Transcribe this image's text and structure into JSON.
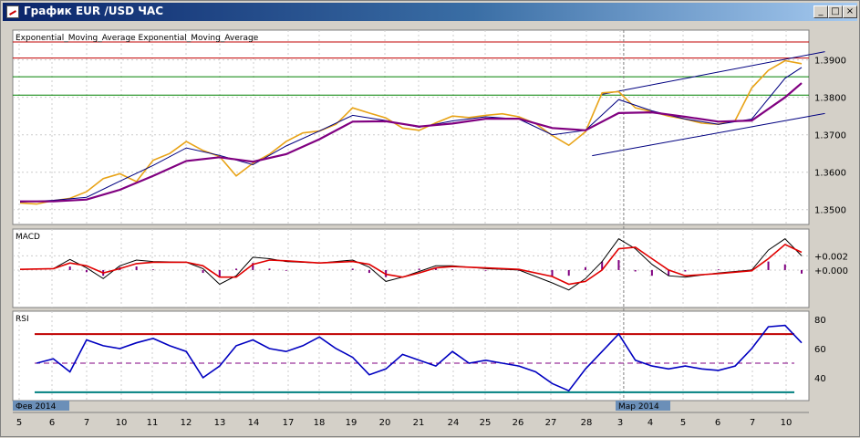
{
  "window": {
    "title": "График EUR /USD  ЧАС",
    "min_glyph": "_",
    "max_glyph": "□",
    "close_glyph": "×"
  },
  "chart_data": [
    {
      "type": "line",
      "title": "Exponential_Moving_Average Exponential_Moving_Average",
      "ylim": [
        1.3475,
        1.3965
      ],
      "y_ticks": [
        "1.3500",
        "1.3600",
        "1.3700",
        "1.3800",
        "1.3900"
      ],
      "x_ticks": [
        "5",
        "6",
        "7",
        "10",
        "11",
        "12",
        "13",
        "14",
        "17",
        "18",
        "19",
        "20",
        "21",
        "24",
        "25",
        "26",
        "27",
        "28",
        "3",
        "4",
        "5",
        "6",
        "7",
        "10"
      ],
      "period_labels": [
        "Фев 2014",
        "Мар 2014"
      ],
      "series": [
        {
          "color": "#e8a317",
          "x": [
            0,
            0.5,
            1,
            1.5,
            2,
            2.5,
            3,
            3.5,
            4,
            4.5,
            5,
            5.5,
            6,
            6.5,
            7,
            7.5,
            8,
            8.5,
            9,
            9.5,
            10,
            10.5,
            11,
            11.5,
            12,
            12.5,
            13,
            13.5,
            14,
            14.5,
            15,
            15.5,
            16,
            16.5,
            17,
            17.5,
            18,
            18.5,
            19,
            19.5,
            20,
            20.5,
            21,
            21.5,
            22,
            22.5,
            23,
            23.5
          ],
          "y": [
            1.3518,
            1.3515,
            1.3524,
            1.353,
            1.3548,
            1.3583,
            1.3596,
            1.3575,
            1.3632,
            1.365,
            1.3682,
            1.3658,
            1.3642,
            1.359,
            1.3624,
            1.3648,
            1.3682,
            1.3705,
            1.371,
            1.3728,
            1.3772,
            1.3758,
            1.3745,
            1.3718,
            1.3712,
            1.3732,
            1.375,
            1.3746,
            1.3752,
            1.3756,
            1.3748,
            1.373,
            1.3698,
            1.3672,
            1.3708,
            1.3812,
            1.3815,
            1.3772,
            1.3762,
            1.375,
            1.3742,
            1.3731,
            1.3728,
            1.3738,
            1.3825,
            1.3872,
            1.3898,
            1.389
          ]
        },
        {
          "color": "#000080",
          "x": [
            0,
            1,
            2,
            3,
            4,
            5,
            6,
            7,
            8,
            9,
            10,
            11,
            12,
            13,
            14,
            15,
            16,
            17,
            18,
            19,
            20,
            21,
            22,
            23,
            23.5
          ],
          "y": [
            1.352,
            1.3525,
            1.3533,
            1.3576,
            1.3618,
            1.3665,
            1.3645,
            1.362,
            1.367,
            1.371,
            1.3752,
            1.3738,
            1.372,
            1.3737,
            1.3748,
            1.3742,
            1.37,
            1.3712,
            1.3794,
            1.3764,
            1.3742,
            1.3728,
            1.3742,
            1.3851,
            1.388
          ]
        },
        {
          "color": "#800080",
          "x": [
            0,
            1,
            2,
            3,
            4,
            5,
            6,
            7,
            8,
            9,
            10,
            11,
            12,
            13,
            14,
            15,
            16,
            17,
            18,
            19,
            20,
            21,
            22,
            23,
            23.5
          ],
          "y": [
            1.3522,
            1.3522,
            1.3527,
            1.3553,
            1.359,
            1.363,
            1.364,
            1.3628,
            1.3648,
            1.3688,
            1.3735,
            1.3736,
            1.3722,
            1.373,
            1.3743,
            1.3743,
            1.3718,
            1.3712,
            1.3758,
            1.376,
            1.3748,
            1.3735,
            1.3738,
            1.38,
            1.3838
          ]
        }
      ],
      "hlines": [
        {
          "value": 1.3948,
          "color": "#c00000"
        },
        {
          "value": 1.3905,
          "color": "#c00000"
        },
        {
          "value": 1.3855,
          "color": "#008000"
        },
        {
          "value": 1.3806,
          "color": "#008000"
        }
      ],
      "trendlines": [
        {
          "x": [
            17.5,
            24.2
          ],
          "y": [
            1.3808,
            1.3922
          ],
          "color": "#000080"
        },
        {
          "x": [
            17.2,
            24.2
          ],
          "y": [
            1.3644,
            1.3757
          ],
          "color": "#000080"
        }
      ],
      "cursor_x": 18.15
    },
    {
      "type": "line",
      "title": "MACD",
      "ylim": [
        -0.0045,
        0.005
      ],
      "y_ticks": [
        "+0.002",
        "+0.000"
      ],
      "y_tick_values": [
        0.002,
        0.0
      ],
      "series": [
        {
          "color": "#000000",
          "x": [
            0,
            1,
            1.5,
            2,
            2.5,
            3,
            3.5,
            4,
            5,
            5.5,
            6,
            6.5,
            7,
            7.5,
            8,
            9,
            10,
            10.5,
            11,
            11.5,
            12,
            12.5,
            13,
            14,
            15,
            16,
            16.5,
            17,
            17.5,
            18,
            18.5,
            19,
            19.5,
            20,
            21,
            22,
            22.5,
            23,
            23.5
          ],
          "y": [
            0.0001,
            0.0002,
            0.0015,
            0.0003,
            -0.0012,
            0.0006,
            0.0014,
            0.0012,
            0.0011,
            0.0002,
            -0.002,
            -0.0008,
            0.0018,
            0.0016,
            0.0012,
            0.001,
            0.0014,
            0.0004,
            -0.0016,
            -0.001,
            -0.0002,
            0.0006,
            0.0006,
            0.0002,
            0.0,
            -0.0018,
            -0.0028,
            -0.0012,
            0.0012,
            0.0044,
            0.003,
            0.0008,
            -0.0008,
            -0.001,
            -0.0004,
            0.0,
            0.0028,
            0.0044,
            0.002
          ]
        },
        {
          "color": "#e00000",
          "x": [
            0,
            1,
            1.5,
            2,
            2.5,
            3,
            3.5,
            4,
            5,
            5.5,
            6,
            6.5,
            7,
            7.5,
            8,
            9,
            10,
            10.5,
            11,
            11.5,
            12,
            12.5,
            13,
            14,
            15,
            16,
            16.5,
            17,
            17.5,
            18,
            18.5,
            19,
            19.5,
            20,
            21,
            22,
            22.5,
            23,
            23.5
          ],
          "y": [
            0.0001,
            0.0002,
            0.001,
            0.0006,
            -0.0004,
            0.0002,
            0.0009,
            0.0011,
            0.0011,
            0.0006,
            -0.001,
            -0.001,
            0.0008,
            0.0014,
            0.0013,
            0.001,
            0.0012,
            0.0008,
            -0.0006,
            -0.001,
            -0.0004,
            0.0003,
            0.0005,
            0.0003,
            0.0001,
            -0.0009,
            -0.002,
            -0.0016,
            0.0,
            0.003,
            0.0032,
            0.0016,
            0.0,
            -0.0008,
            -0.0005,
            -0.0001,
            0.0016,
            0.0036,
            0.0025
          ]
        }
      ]
    },
    {
      "type": "line",
      "title": "RSI",
      "ylim": [
        28,
        82
      ],
      "y_ticks": [
        "80",
        "60",
        "40"
      ],
      "y_tick_values": [
        80,
        60,
        40
      ],
      "levels": [
        {
          "value": 70,
          "color": "#c00000"
        },
        {
          "value": 50,
          "color": "#800080"
        },
        {
          "value": 30,
          "color": "#008080"
        }
      ],
      "series": [
        {
          "color": "#0000c0",
          "x": [
            0.5,
            1,
            1.5,
            2,
            2.5,
            3,
            3.5,
            4,
            4.5,
            5,
            5.5,
            6,
            6.5,
            7,
            7.5,
            8,
            8.5,
            9,
            9.5,
            10,
            10.5,
            11,
            11.5,
            12,
            12.5,
            13,
            13.5,
            14,
            14.5,
            15,
            15.5,
            16,
            16.5,
            17,
            17.5,
            18,
            18.5,
            19,
            19.5,
            20,
            20.5,
            21,
            21.5,
            22,
            22.5,
            23,
            23.5
          ],
          "y": [
            50,
            53,
            44,
            66,
            62,
            60,
            64,
            67,
            62,
            58,
            40,
            48,
            62,
            66,
            60,
            58,
            62,
            68,
            60,
            54,
            42,
            46,
            56,
            52,
            48,
            58,
            50,
            52,
            50,
            48,
            44,
            36,
            31,
            46,
            58,
            70,
            52,
            48,
            46,
            48,
            46,
            45,
            48,
            60,
            75,
            76,
            64
          ]
        }
      ]
    }
  ]
}
